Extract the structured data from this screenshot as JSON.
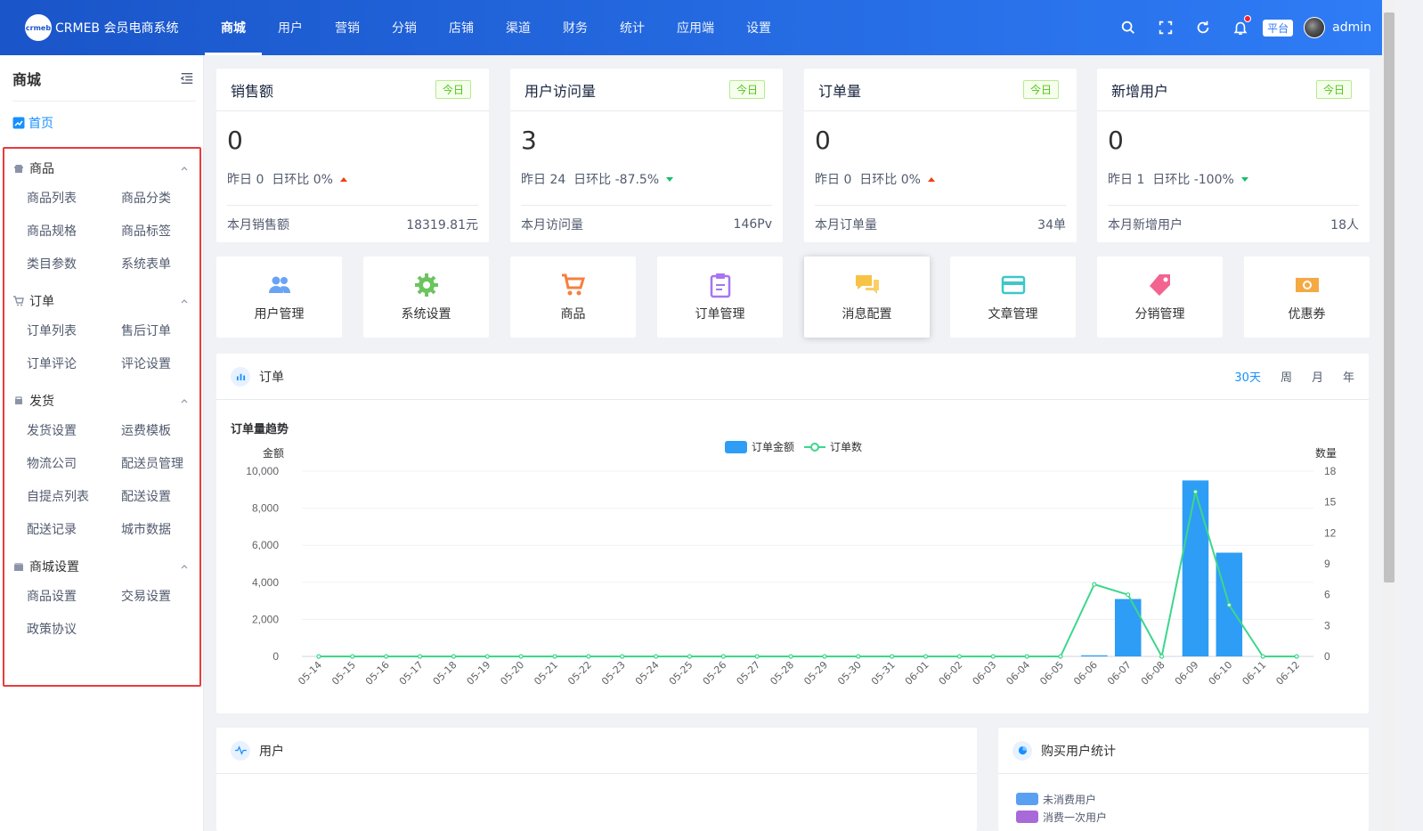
{
  "brand": {
    "logo_mark": "crmeb",
    "name": "CRMEB 会员电商系统"
  },
  "topnav": [
    {
      "label": "商城",
      "active": true
    },
    {
      "label": "用户"
    },
    {
      "label": "营销"
    },
    {
      "label": "分销"
    },
    {
      "label": "店铺"
    },
    {
      "label": "渠道"
    },
    {
      "label": "财务"
    },
    {
      "label": "统计"
    },
    {
      "label": "应用端"
    },
    {
      "label": "设置"
    }
  ],
  "topright": {
    "platform_badge": "平台",
    "user_name": "admin",
    "icons": [
      "search-icon",
      "fullscreen-icon",
      "refresh-icon",
      "bell-icon"
    ]
  },
  "sidebar": {
    "title": "商城",
    "home": "首页",
    "groups": [
      {
        "title": "商品",
        "icon": "shop-icon",
        "items": [
          "商品列表",
          "商品分类",
          "商品规格",
          "商品标签",
          "类目参数",
          "系统表单"
        ]
      },
      {
        "title": "订单",
        "icon": "cart-icon",
        "items": [
          "订单列表",
          "售后订单",
          "订单评论",
          "评论设置"
        ]
      },
      {
        "title": "发货",
        "icon": "truck-icon",
        "items": [
          "发货设置",
          "运费模板",
          "物流公司",
          "配送员管理",
          "自提点列表",
          "配送设置",
          "配送记录",
          "城市数据"
        ]
      },
      {
        "title": "商城设置",
        "icon": "store-icon",
        "items": [
          "商品设置",
          "交易设置",
          "政策协议"
        ]
      }
    ]
  },
  "stats": [
    {
      "title": "销售额",
      "tag": "今日",
      "value": "0",
      "compare": "昨日 0  日环比 0%",
      "trend": "up",
      "foot_label": "本月销售额",
      "foot_value": "18319.81元"
    },
    {
      "title": "用户访问量",
      "tag": "今日",
      "value": "3",
      "compare": "昨日 24  日环比 -87.5%",
      "trend": "down",
      "foot_label": "本月访问量",
      "foot_value": "146Pv"
    },
    {
      "title": "订单量",
      "tag": "今日",
      "value": "0",
      "compare": "昨日 0  日环比 0%",
      "trend": "up",
      "foot_label": "本月订单量",
      "foot_value": "34单"
    },
    {
      "title": "新增用户",
      "tag": "今日",
      "value": "0",
      "compare": "昨日 1  日环比 -100%",
      "trend": "down",
      "foot_label": "本月新增用户",
      "foot_value": "18人"
    }
  ],
  "quick": [
    {
      "label": "用户管理",
      "icon": "users-icon",
      "color": "#69a3f3"
    },
    {
      "label": "系统设置",
      "icon": "gear-icon",
      "color": "#6bc45e"
    },
    {
      "label": "商品",
      "icon": "cart-icon",
      "color": "#f5803e"
    },
    {
      "label": "订单管理",
      "icon": "clipboard-icon",
      "color": "#a874f0"
    },
    {
      "label": "消息配置",
      "icon": "chat-icon",
      "color": "#f6c344"
    },
    {
      "label": "文章管理",
      "icon": "card-icon",
      "color": "#3ec7c7"
    },
    {
      "label": "分销管理",
      "icon": "tag-icon",
      "color": "#f2648f"
    },
    {
      "label": "优惠券",
      "icon": "coupon-icon",
      "color": "#f5a943"
    }
  ],
  "order_panel": {
    "title": "订单",
    "periods": [
      "30天",
      "周",
      "月",
      "年"
    ],
    "active_period": "30天",
    "chart_title": "订单量趋势"
  },
  "chart_data": {
    "type": "bar",
    "title": "订单量趋势",
    "legend": [
      "订单金额",
      "订单数"
    ],
    "ylabel": "金额",
    "y2label": "数量",
    "ylim": [
      0,
      10000
    ],
    "y2lim": [
      0,
      18
    ],
    "yticks": [
      "10,000",
      "8,000",
      "6,000",
      "4,000",
      "2,000",
      "0"
    ],
    "y2ticks": [
      "18",
      "15",
      "12",
      "9",
      "6",
      "3",
      "0"
    ],
    "categories": [
      "05-14",
      "05-15",
      "05-16",
      "05-17",
      "05-18",
      "05-19",
      "05-20",
      "05-21",
      "05-22",
      "05-23",
      "05-24",
      "05-25",
      "05-26",
      "05-27",
      "05-28",
      "05-29",
      "05-30",
      "05-31",
      "06-01",
      "06-02",
      "06-03",
      "06-04",
      "06-05",
      "06-06",
      "06-07",
      "06-08",
      "06-09",
      "06-10",
      "06-11",
      "06-12"
    ],
    "series": [
      {
        "name": "订单金额",
        "type": "bar",
        "color": "#2e9df5",
        "values": [
          0,
          0,
          0,
          0,
          0,
          0,
          0,
          0,
          0,
          0,
          0,
          0,
          0,
          0,
          0,
          0,
          0,
          0,
          0,
          0,
          0,
          0,
          0,
          60,
          3100,
          0,
          9500,
          5600,
          0,
          0
        ]
      },
      {
        "name": "订单数",
        "type": "line",
        "color": "#3dd68c",
        "values": [
          0,
          0,
          0,
          0,
          0,
          0,
          0,
          0,
          0,
          0,
          0,
          0,
          0,
          0,
          0,
          0,
          0,
          0,
          0,
          0,
          0,
          0,
          0,
          7,
          6,
          0,
          16,
          5,
          0,
          0
        ]
      }
    ],
    "grid": true,
    "legend_position": "top-center"
  },
  "user_panel": {
    "title": "用户"
  },
  "buyer_panel": {
    "title": "购买用户统计",
    "legend": [
      {
        "label": "未消费用户",
        "color": "#5aa0f2"
      },
      {
        "label": "消费一次用户",
        "color": "#a86ad8"
      }
    ]
  }
}
